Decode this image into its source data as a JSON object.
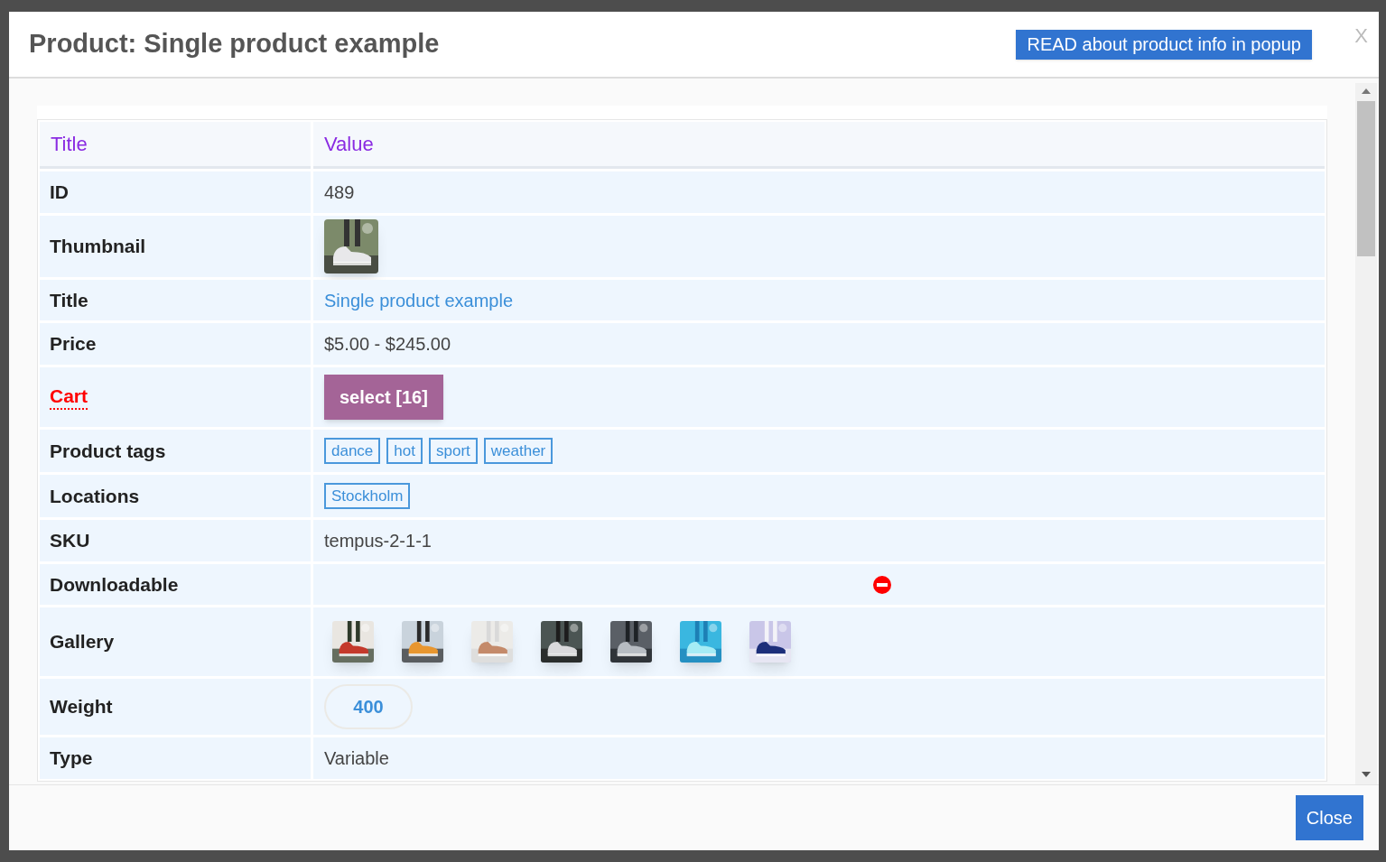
{
  "modal": {
    "title": "Product: Single product example",
    "read_button": "READ about product info in popup",
    "close_x": "X",
    "close_button": "Close"
  },
  "table": {
    "columns": [
      "Title",
      "Value"
    ],
    "rows": [
      {
        "label": "ID",
        "emphasis": false,
        "kind": "text",
        "value": "489"
      },
      {
        "label": "Thumbnail",
        "emphasis": false,
        "kind": "picture"
      },
      {
        "label": "Title",
        "emphasis": false,
        "kind": "link",
        "value": "Single product example"
      },
      {
        "label": "Price",
        "emphasis": false,
        "kind": "text",
        "value": "$5.00 - $245.00"
      },
      {
        "label": "Cart",
        "emphasis": true,
        "kind": "button",
        "value": "select [16]"
      },
      {
        "label": "Product tags",
        "emphasis": false,
        "kind": "tags",
        "tags": [
          "dance",
          "hot",
          "sport",
          "weather"
        ]
      },
      {
        "label": "Locations",
        "emphasis": false,
        "kind": "tags",
        "tags": [
          "Stockholm"
        ]
      },
      {
        "label": "SKU",
        "emphasis": false,
        "kind": "text",
        "value": "tempus-2-1-1"
      },
      {
        "label": "Downloadable",
        "emphasis": false,
        "kind": "flag",
        "downloadable": false
      },
      {
        "label": "Gallery",
        "emphasis": false,
        "kind": "gallery"
      },
      {
        "label": "Weight",
        "emphasis": false,
        "kind": "pill",
        "value": "400"
      },
      {
        "label": "Type",
        "emphasis": false,
        "kind": "text",
        "value": "Variable"
      }
    ]
  }
}
